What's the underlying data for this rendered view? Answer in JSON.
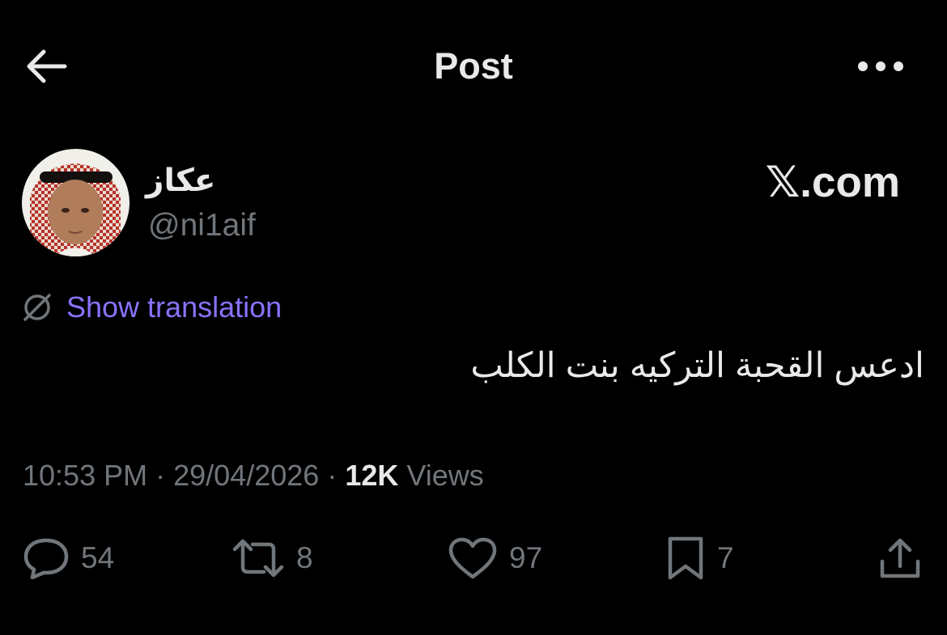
{
  "header": {
    "title": "Post",
    "back_icon": "arrow-left-icon",
    "more_icon": "more-horizontal-icon"
  },
  "author": {
    "display_name": "عكاز",
    "handle": "@ni1aif",
    "avatar": "profile-photo"
  },
  "watermark": "𝕏.com",
  "translation": {
    "label": "Show translation",
    "icon": "globe-icon"
  },
  "tweet": {
    "text": "ادعس القحبة التركيه بنت الكلب"
  },
  "meta": {
    "time": "10:53 PM",
    "separator": "·",
    "date": "29/04/2026",
    "views_count": "12K",
    "views_label": "Views"
  },
  "actions": {
    "replies": "54",
    "reposts": "8",
    "likes": "97",
    "bookmarks": "7"
  },
  "colors": {
    "background": "#000000",
    "text_primary": "#e7e9ea",
    "text_secondary": "#71767b",
    "link": "#8a72ff"
  }
}
